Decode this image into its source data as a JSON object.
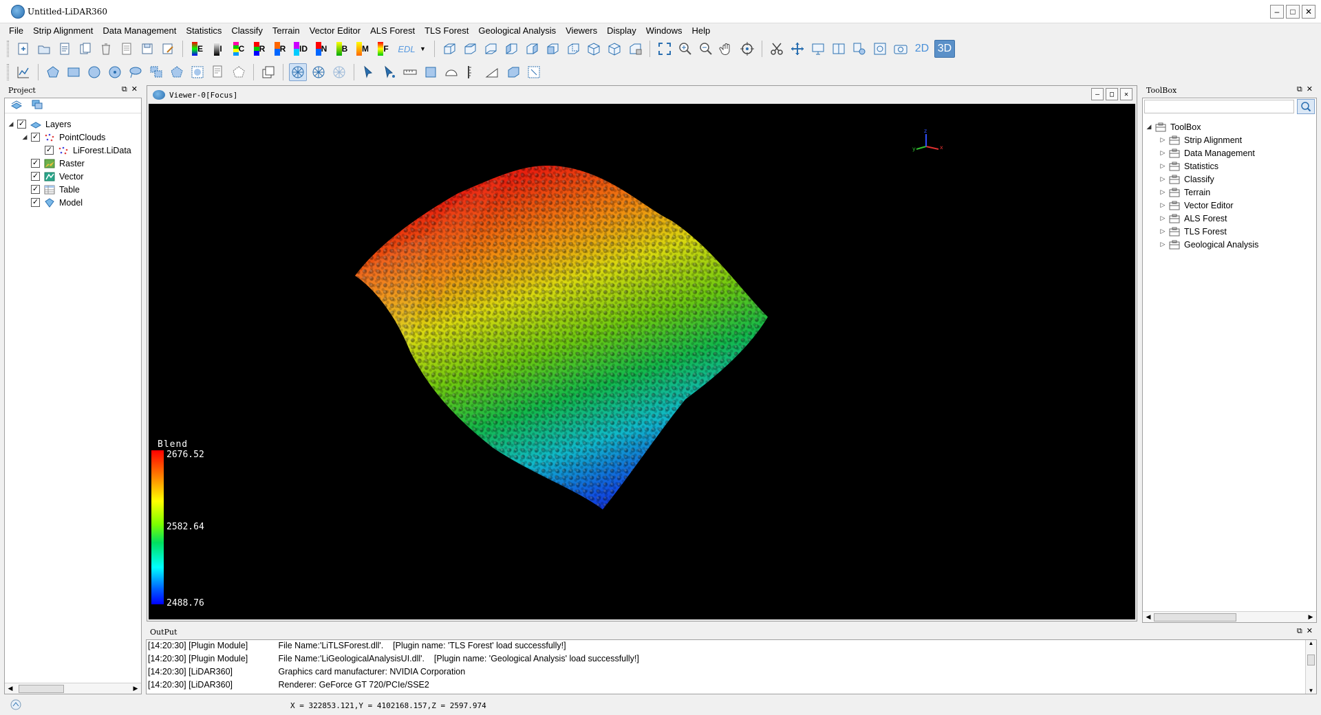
{
  "window": {
    "title": "Untitled-LiDAR360",
    "controls": {
      "minimize": "–",
      "maximize": "□",
      "close": "✕"
    }
  },
  "menu": [
    "File",
    "Strip Alignment",
    "Data Management",
    "Statistics",
    "Classify",
    "Terrain",
    "Vector Editor",
    "ALS Forest",
    "TLS Forest",
    "Geological Analysis",
    "Viewers",
    "Display",
    "Windows",
    "Help"
  ],
  "toolbar": {
    "render_letters": [
      "E",
      "I",
      "C",
      "R",
      "ID",
      "N",
      "B",
      "M",
      "F"
    ],
    "edl_label": "EDL",
    "mode_2d": "2D",
    "mode_3d": "3D"
  },
  "project": {
    "title": "Project",
    "tree": {
      "layers": "Layers",
      "pointclouds": "PointClouds",
      "file": "LiForest.LiData",
      "raster": "Raster",
      "vector": "Vector",
      "table": "Table",
      "model": "Model"
    }
  },
  "viewer": {
    "title": "Viewer-0[Focus]",
    "legend": {
      "title": "Blend",
      "max": "2676.52",
      "mid": "2582.64",
      "min": "2488.76"
    },
    "axes": {
      "x": "x",
      "y": "y",
      "z": "z"
    }
  },
  "toolbox": {
    "title": "ToolBox",
    "search_placeholder": "",
    "root": "ToolBox",
    "items": [
      "Strip Alignment",
      "Data Management",
      "Statistics",
      "Classify",
      "Terrain",
      "Vector Editor",
      "ALS Forest",
      "TLS Forest",
      "Geological Analysis"
    ]
  },
  "output": {
    "title": "OutPut",
    "lines": [
      {
        "time": "[14:20:30]",
        "source": "[Plugin Module]",
        "message": "File Name:'LiTLSForest.dll'.    [Plugin name: 'TLS Forest' load successfully!]"
      },
      {
        "time": "[14:20:30]",
        "source": "[Plugin Module]",
        "message": "File Name:'LiGeologicalAnalysisUI.dll'.    [Plugin name: 'Geological Analysis' load successfully!]"
      },
      {
        "time": "[14:20:30]",
        "source": "[LiDAR360]",
        "message": "Graphics card manufacturer: NVIDIA Corporation"
      },
      {
        "time": "[14:20:30]",
        "source": "[LiDAR360]",
        "message": "Renderer: GeForce GT 720/PCIe/SSE2"
      }
    ]
  },
  "status": {
    "coordinates": "X = 322853.121,Y = 4102168.157,Z = 2597.974"
  },
  "colors": {
    "accent": "#2a6fb0",
    "canvas": "#000000",
    "elevation_high": "#ff0000",
    "elevation_low": "#0000ff"
  }
}
